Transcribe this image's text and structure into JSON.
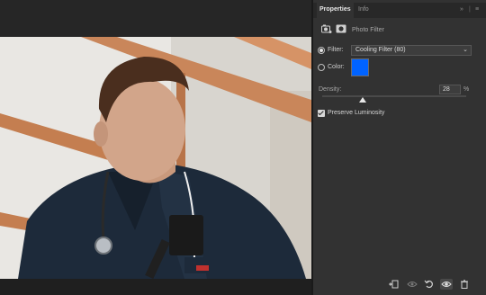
{
  "panel": {
    "tabs": [
      {
        "label": "Properties",
        "active": true
      },
      {
        "label": "Info",
        "active": false
      }
    ],
    "collapse_glyph": "»",
    "menu_glyph": "≡",
    "header": {
      "icons": [
        "adjustment-layer-icon",
        "layer-mask-icon"
      ],
      "title": "Photo Filter"
    },
    "filter": {
      "label": "Filter:",
      "value": "Cooling Filter (80)",
      "selected": true
    },
    "color": {
      "label": "Color:",
      "swatch": "#0063ff",
      "selected": false
    },
    "density": {
      "label": "Density:",
      "value": "28",
      "unit": "%",
      "fraction": 0.28
    },
    "preserve_luminosity": {
      "label": "Preserve Luminosity",
      "checked": true
    },
    "footer_icons": [
      "clip-to-layer-icon",
      "view-previous-state-icon",
      "reset-icon",
      "visibility-eye-icon",
      "trash-icon"
    ]
  },
  "colors": {
    "panel_bg": "#323232",
    "workspace_bg": "#262626",
    "accent_swatch": "#0063ff"
  }
}
